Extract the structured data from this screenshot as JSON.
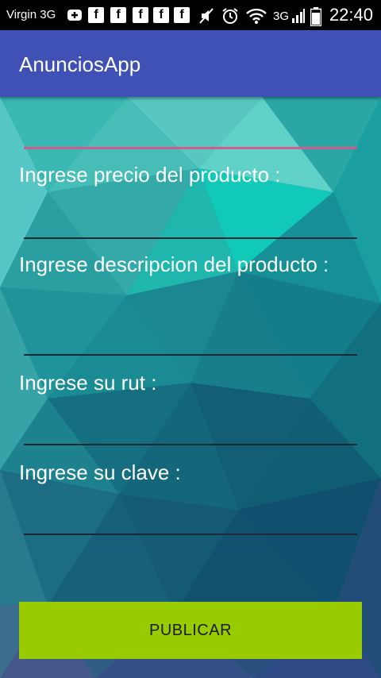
{
  "status_bar": {
    "carrier": "Virgin 3G",
    "network": "3G",
    "time": "22:40",
    "icons": [
      "plus-icon",
      "facebook-icon",
      "facebook-icon",
      "facebook-icon",
      "facebook-icon",
      "facebook-icon",
      "mute-icon",
      "alarm-icon",
      "wifi-icon",
      "signal-icon",
      "battery-icon"
    ]
  },
  "app_bar": {
    "title": "AnunciosApp"
  },
  "form": {
    "fields": [
      {
        "label": "Ingrese precio del producto :"
      },
      {
        "label": "Ingrese descripcion del producto :"
      },
      {
        "label": "Ingrese su rut :"
      },
      {
        "label": "Ingrese su clave :"
      }
    ],
    "submit_label": "PUBLICAR"
  },
  "colors": {
    "app_bar": "#3f51b5",
    "accent": "#d15a8f",
    "button": "#99cc00"
  }
}
